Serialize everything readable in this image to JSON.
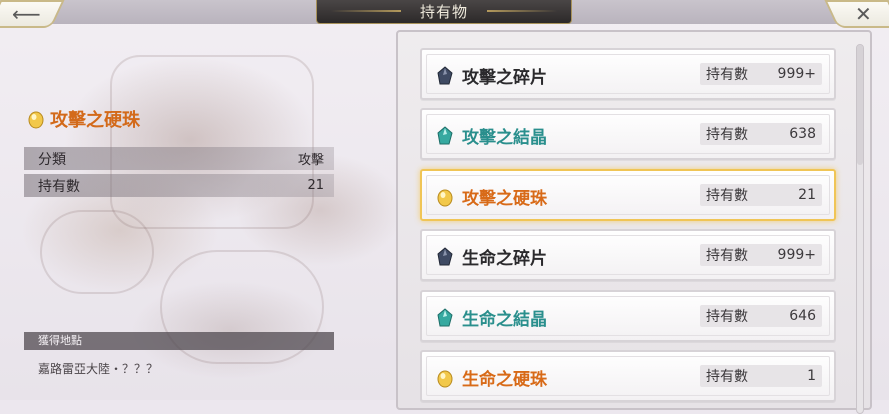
{
  "header": {
    "title": "持有物",
    "back_icon": "arrow-left-icon",
    "close_icon": "close-icon"
  },
  "detail": {
    "item_name": "攻擊之硬珠",
    "icon": "yellow-gem-icon",
    "rows": [
      {
        "label": "分類",
        "value": "攻擊"
      },
      {
        "label": "持有數",
        "value": "21"
      }
    ],
    "location_header": "獲得地點",
    "location": "嘉路雷亞大陸・？？？"
  },
  "items": [
    {
      "name": "攻擊之碎片",
      "hold_label": "持有數",
      "count": "999+",
      "tier": "gray",
      "icon": "dark-shard-icon",
      "selected": false
    },
    {
      "name": "攻擊之結晶",
      "hold_label": "持有數",
      "count": "638",
      "tier": "teal",
      "icon": "teal-crystal-icon",
      "selected": false
    },
    {
      "name": "攻擊之硬珠",
      "hold_label": "持有數",
      "count": "21",
      "tier": "orange",
      "icon": "yellow-gem-icon",
      "selected": true
    },
    {
      "name": "生命之碎片",
      "hold_label": "持有數",
      "count": "999+",
      "tier": "gray",
      "icon": "dark-shard-icon",
      "selected": false
    },
    {
      "name": "生命之結晶",
      "hold_label": "持有數",
      "count": "646",
      "tier": "teal",
      "icon": "teal-crystal-icon",
      "selected": false
    },
    {
      "name": "生命之硬珠",
      "hold_label": "持有數",
      "count": "1",
      "tier": "orange",
      "icon": "yellow-gem-icon",
      "selected": false
    }
  ],
  "colors": {
    "gray": "#2b2a2d",
    "teal": "#2a8f8d",
    "orange": "#d86a18",
    "selected_border": "#f0c556"
  }
}
